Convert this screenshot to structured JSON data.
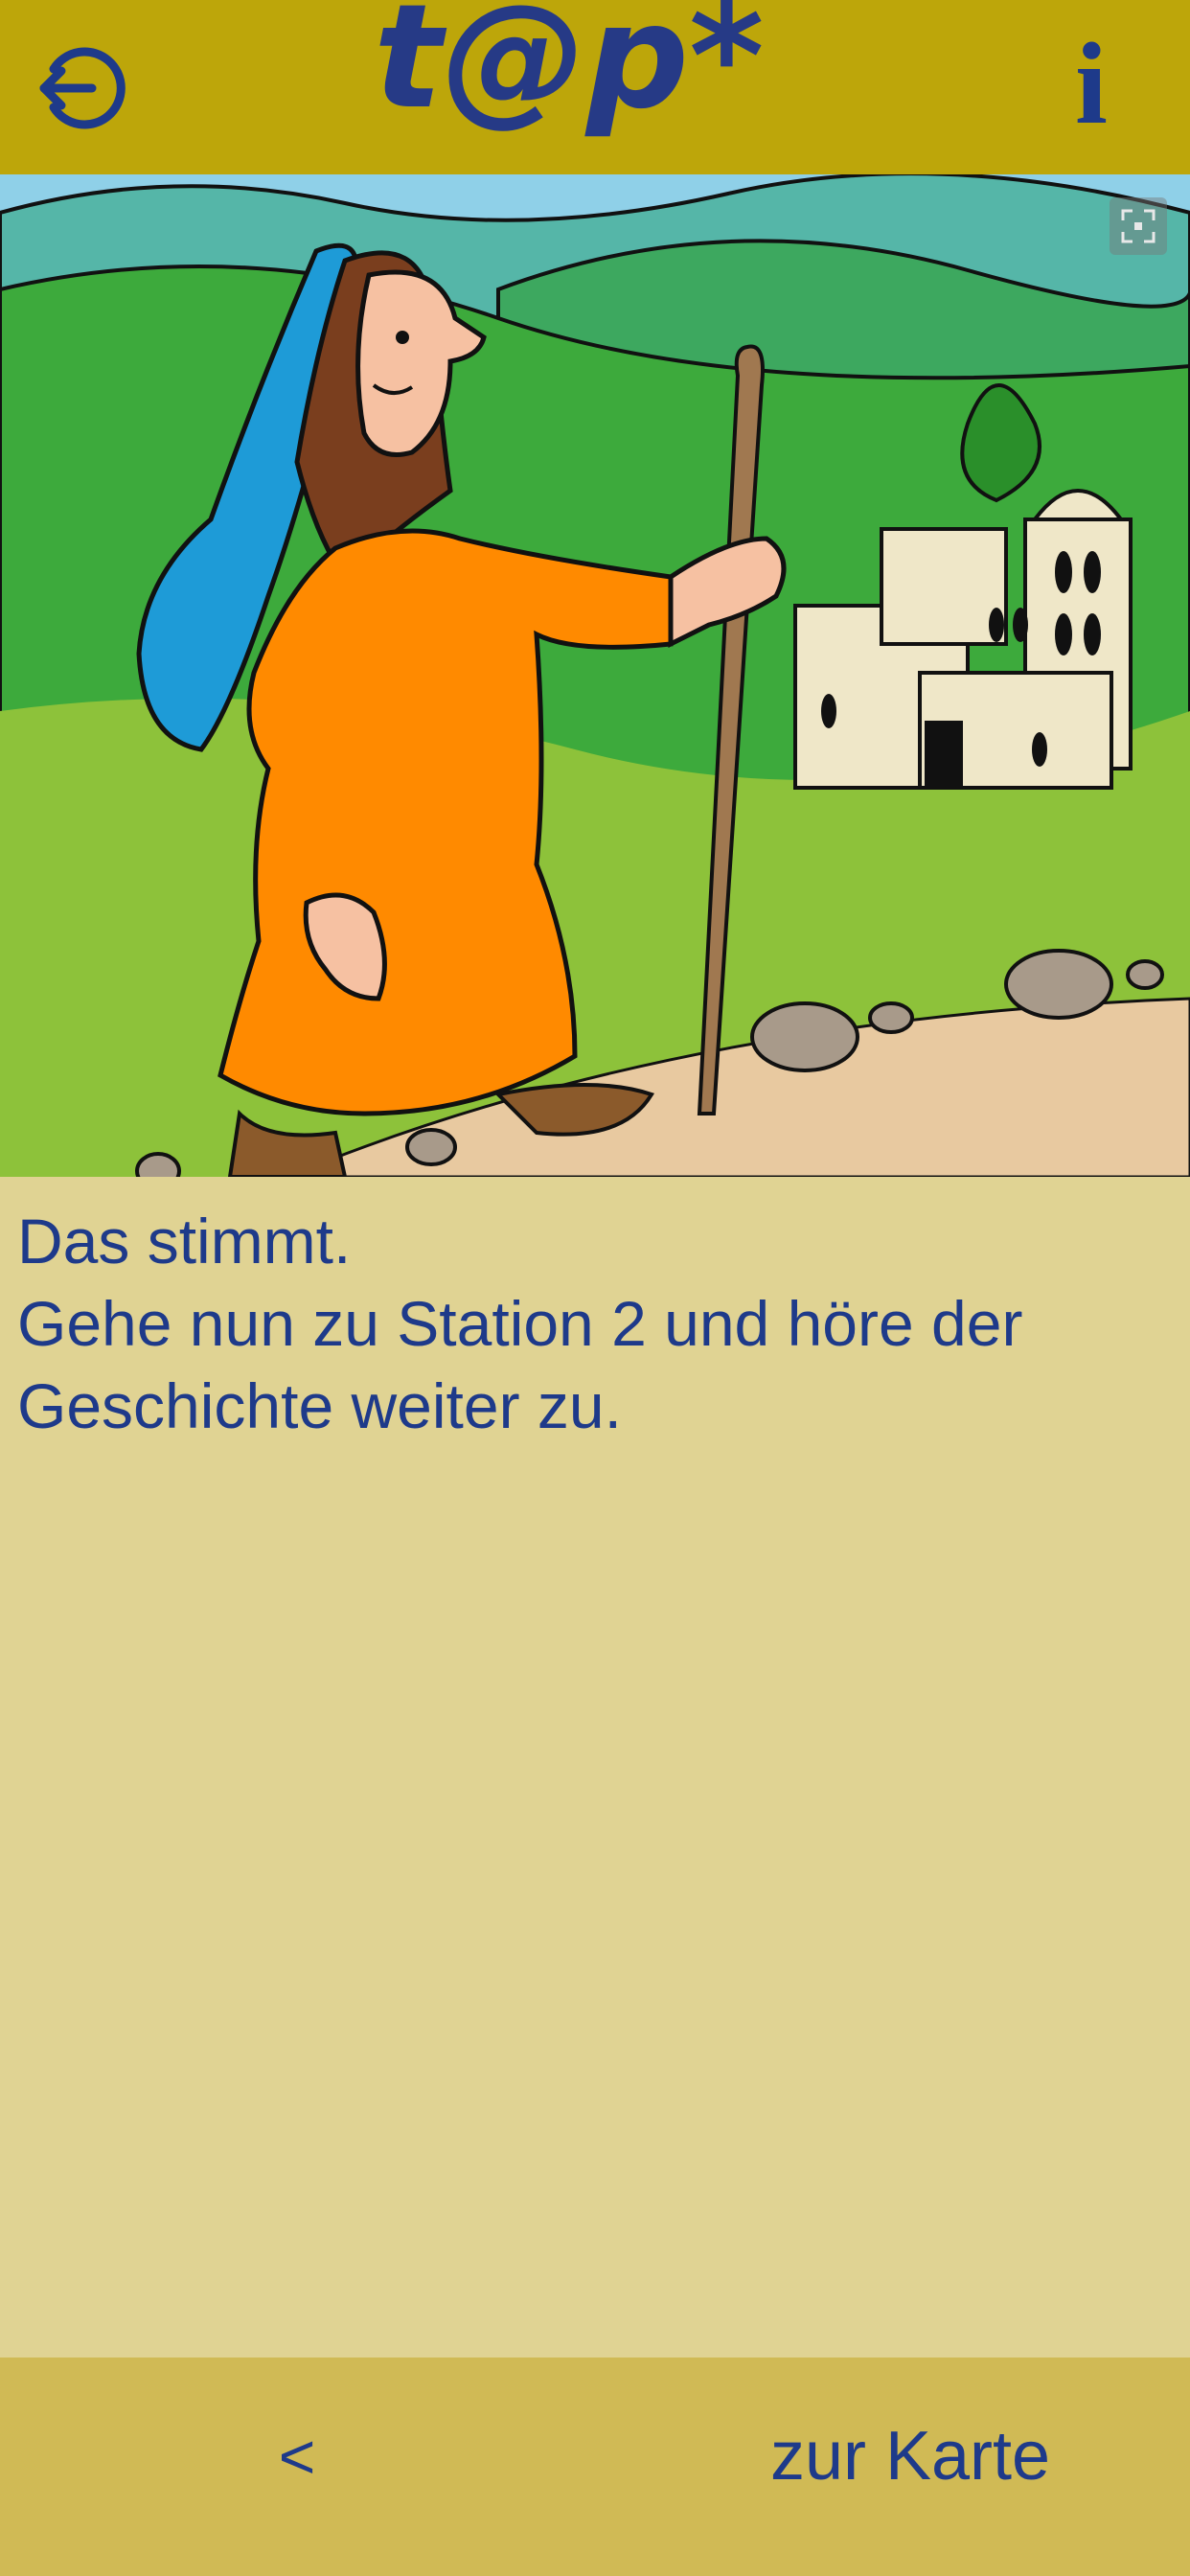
{
  "header": {
    "logo_text": "t@p*",
    "logout_icon": "logout-arrow-icon",
    "info_label": "i"
  },
  "image": {
    "alt": "",
    "fullscreen_icon": "fullscreen-icon"
  },
  "content": {
    "line1": "Das stimmt.",
    "line2": "Gehe nun zu Station 2 und höre der Geschichte weiter zu."
  },
  "footer": {
    "back_label": "<",
    "map_label": "zur Karte"
  },
  "colors": {
    "header_bg": "#BDA60A",
    "page_bg": "#E0D393",
    "footer_bg": "#D0BA55",
    "text": "#1E3A8A"
  }
}
